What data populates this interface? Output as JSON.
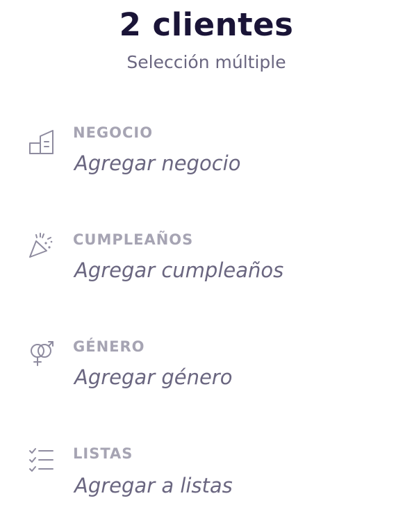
{
  "header": {
    "title": "2 clientes",
    "subtitle": "Selección múltiple"
  },
  "fields": [
    {
      "label": "NEGOCIO",
      "value": "Agregar negocio",
      "icon": "building-icon"
    },
    {
      "label": "CUMPLEAÑOS",
      "value": "Agregar cumpleaños",
      "icon": "party-popper-icon"
    },
    {
      "label": "GÉNERO",
      "value": "Agregar género",
      "icon": "gender-icon"
    },
    {
      "label": "LISTAS",
      "value": "Agregar a listas",
      "icon": "checklist-icon"
    }
  ],
  "colors": {
    "title": "#1a1437",
    "text": "#6a6680",
    "label": "#a6a4b3",
    "icon": "#8e8b9f"
  }
}
